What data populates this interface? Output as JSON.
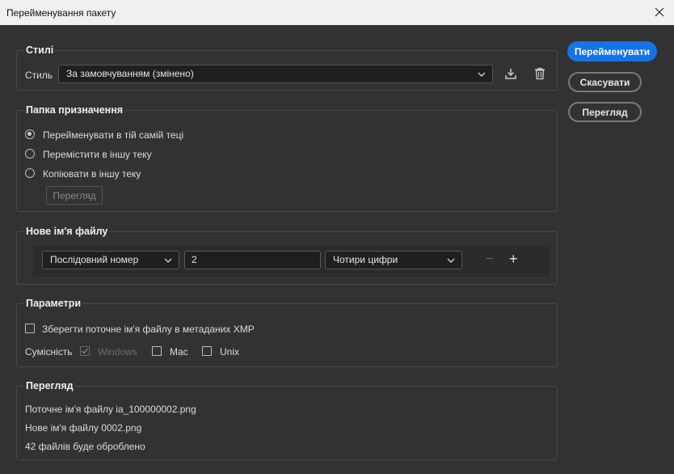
{
  "window": {
    "title": "Перейменування пакету",
    "close_icon": "close-icon"
  },
  "actions": {
    "rename": "Перейменувати",
    "cancel": "Скасувати",
    "preview": "Перегляд"
  },
  "styles": {
    "legend": "Стилі",
    "style_label": "Стиль",
    "style_value": "За замовчуванням (змінено)"
  },
  "destination": {
    "legend": "Папка призначення",
    "options": [
      "Перейменувати в тій самій теці",
      "Перемістити в іншу теку",
      "Копіювати в іншу теку"
    ],
    "selected_index": 0,
    "browse_label": "Перегляд"
  },
  "new_name": {
    "legend": "Нове ім'я файлу",
    "type_value": "Послідовний номер",
    "number_value": "2",
    "digits_value": "Чотири цифри",
    "minus": "−",
    "plus": "+"
  },
  "params": {
    "legend": "Параметри",
    "keep_xmp_label": "Зберегти поточне ім'я файлу в метаданих XMP",
    "keep_xmp_checked": false,
    "compat_label": "Сумісність",
    "windows_label": "Windows",
    "windows_checked": true,
    "mac_label": "Mac",
    "mac_checked": false,
    "unix_label": "Unix",
    "unix_checked": false
  },
  "preview": {
    "legend": "Перегляд",
    "current_name": "Поточне ім'я файлу ia_100000002.png",
    "new_name": "Нове ім'я файлу 0002.png",
    "count": "42 файлів буде оброблено"
  },
  "colors": {
    "accent": "#1473e6",
    "background": "#323232",
    "titlebar": "#f0f0f0"
  }
}
